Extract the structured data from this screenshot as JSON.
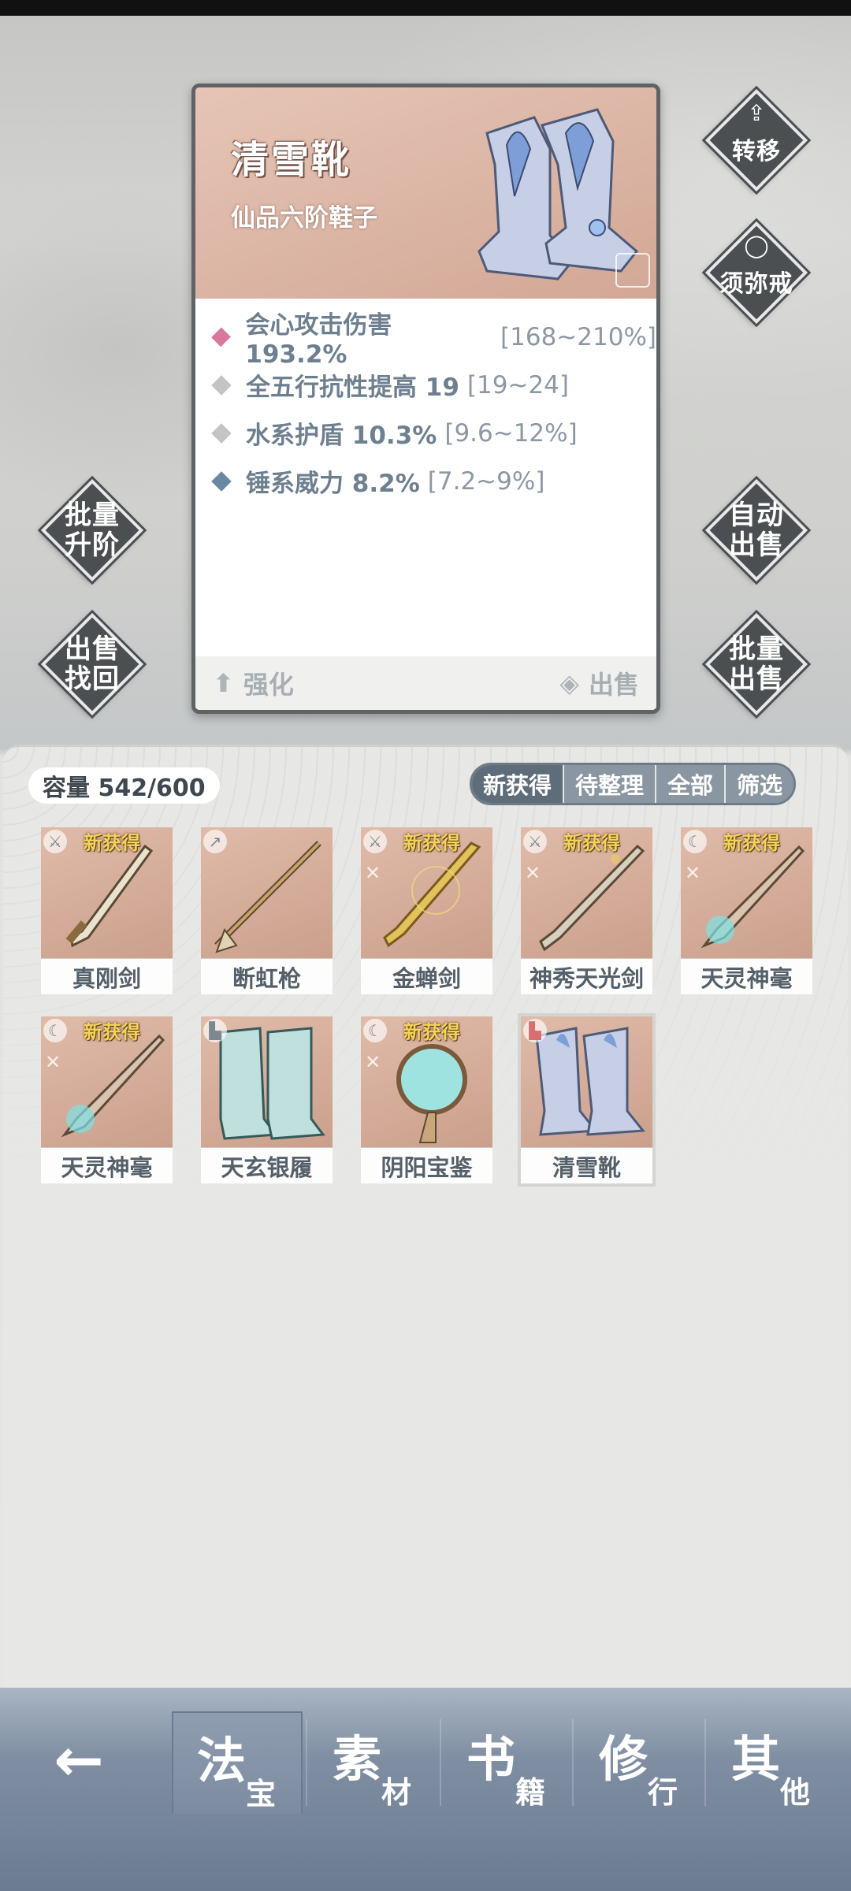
{
  "item_card": {
    "name": "清雪靴",
    "subtitle": "仙品六阶鞋子",
    "stats": [
      {
        "text": "会心攻击伤害 193.2%",
        "range": "[168~210%]",
        "gem_color": "#d8789c"
      },
      {
        "text": "全五行抗性提高 19",
        "range": "[19~24]",
        "gem_color": "#c2c4c6"
      },
      {
        "text": "水系护盾 10.3%",
        "range": "[9.6~12%]",
        "gem_color": "#c2c4c6"
      },
      {
        "text": "锤系威力 8.2%",
        "range": "[7.2~9%]",
        "gem_color": "#6a88a2"
      }
    ],
    "enhance_label": "强化",
    "sell_label": "出售"
  },
  "side_buttons": {
    "transfer": "转移",
    "sumeru_ring": "须弥戒",
    "batch_upgrade": "批量\n升阶",
    "auto_sell": "自动\n出售",
    "sell_retrieve": "出售\n找回",
    "batch_sell": "批量\n出售"
  },
  "inventory": {
    "capacity": "容量 542/600",
    "filters": [
      "新获得",
      "待整理",
      "全部",
      "筛选"
    ],
    "active_filter": "新获得",
    "items": [
      {
        "name": "真刚剑",
        "new": "新获得",
        "type_icon": "sword-icon"
      },
      {
        "name": "断虹枪",
        "new": "",
        "type_icon": "spear-icon"
      },
      {
        "name": "金蝉剑",
        "new": "新获得",
        "type_icon": "sword-icon"
      },
      {
        "name": "神秀天光剑",
        "new": "新获得",
        "type_icon": "sword-icon"
      },
      {
        "name": "天灵神毫",
        "new": "新获得",
        "type_icon": "brush-icon"
      },
      {
        "name": "天灵神毫",
        "new": "新获得",
        "type_icon": "brush-icon"
      },
      {
        "name": "天玄银履",
        "new": "",
        "type_icon": "boot-icon"
      },
      {
        "name": "阴阳宝鉴",
        "new": "新获得",
        "type_icon": "mirror-icon"
      },
      {
        "name": "清雪靴",
        "new": "",
        "type_icon": "boot-icon"
      }
    ]
  },
  "bottom_nav": {
    "back_icon": "arrow-left-icon",
    "tabs": [
      {
        "big": "法",
        "small": "宝"
      },
      {
        "big": "素",
        "small": "材"
      },
      {
        "big": "书",
        "small": "籍"
      },
      {
        "big": "修",
        "small": "行"
      },
      {
        "big": "其",
        "small": "他"
      }
    ],
    "active_tab": "法宝"
  }
}
